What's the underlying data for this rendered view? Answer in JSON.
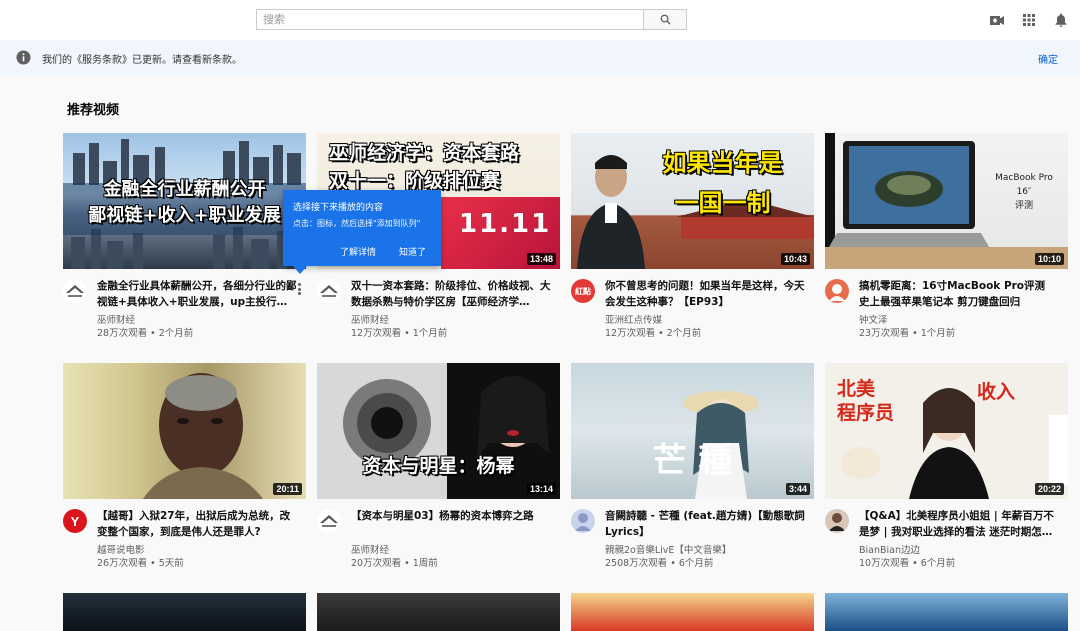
{
  "header": {
    "search_placeholder": "搜索",
    "accent": "#065fd4"
  },
  "banner": {
    "message": "我们的《服务条款》已更新。请查看新条款。",
    "confirm": "确定"
  },
  "section_title": "推荐视频",
  "tooltip": {
    "title": "选择接下来播放的内容",
    "hint": "点击：图标，然后选择\"添加到队列\"",
    "learn_more": "了解详情",
    "got_it": "知道了"
  },
  "videos": [
    {
      "thumb_text": "金融全行业薪酬公开\n鄙视链+收入+职业发展",
      "title": "金融全行业具体薪酬公开，各细分行业的鄙视链+具体收入+职业发展，up主投行…",
      "channel": "巫师财经",
      "stats": "28万次观看 • 2个月前",
      "duration": ""
    },
    {
      "thumb_text": "巫师经济学：资本套路\n双十一：阶级排位赛",
      "title": "双十一资本套路：阶级排位、价格歧视、大数据杀熟与特价学区房【巫师经济学…",
      "channel": "巫师财经",
      "stats": "12万次观看 • 1个月前",
      "duration": "13:48"
    },
    {
      "thumb_text": "如果当年是\n一国一制",
      "title": "你不曾思考的问题！如果当年是这样，今天会发生这种事？【EP93】",
      "channel": "亚洲红点传媒",
      "stats": "12万次观看 • 2个月前",
      "duration": "10:43"
    },
    {
      "thumb_text": "MacBook Pro\n16″\n评测",
      "title": "搞机零距离：16寸MacBook Pro评测 史上最强苹果笔记本 剪刀键盘回归",
      "channel": "钟文泽",
      "stats": "23万次观看 • 1个月前",
      "duration": "10:10"
    },
    {
      "thumb_text": "",
      "title": "【越哥】入狱27年，出狱后成为总统，改变整个国家，到底是伟人还是罪人?",
      "channel": "越哥说电影",
      "stats": "26万次观看 • 5天前",
      "duration": "20:11"
    },
    {
      "thumb_text": "资本与明星：杨幂",
      "title": "【资本与明星03】杨幂的资本博弈之路",
      "channel": "巫师财经",
      "stats": "20万次观看 • 1周前",
      "duration": "13:14"
    },
    {
      "thumb_text": "芒 種",
      "title": "音闕詩聽 - 芒種 (feat.趙方婧)【動態歌詞Lyrics】",
      "channel": "親親2o音樂LivE【中文音樂】",
      "stats": "2508万次观看 • 6个月前",
      "duration": "3:44"
    },
    {
      "thumb_text": "北美\n程序员",
      "title": "【Q&A】北美程序员小姐姐 | 年薪百万不是梦 | 我对职业选择的看法 迷茫时期怎…",
      "channel": "BianBian边边",
      "stats": "10万次观看 • 6个月前",
      "duration": "20:22"
    }
  ]
}
